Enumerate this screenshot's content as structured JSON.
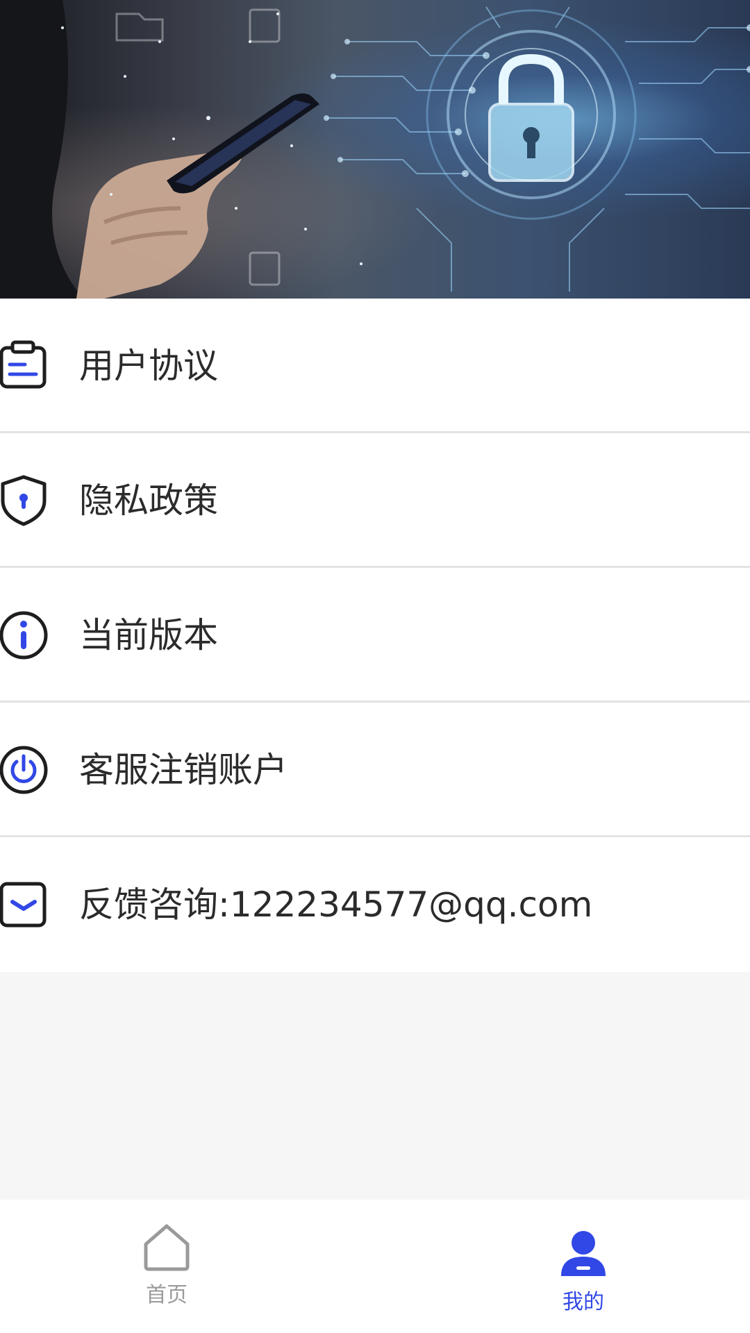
{
  "hero": {
    "icon": "security-lock-banner"
  },
  "menu": {
    "items": [
      {
        "label": "用户协议",
        "icon": "clipboard-icon"
      },
      {
        "label": "隐私政策",
        "icon": "shield-icon"
      },
      {
        "label": "当前版本",
        "icon": "info-icon"
      },
      {
        "label": "客服注销账户",
        "icon": "power-icon"
      },
      {
        "label": "反馈咨询:122234577@qq.com",
        "icon": "mail-icon"
      }
    ]
  },
  "tabbar": {
    "home_label": "首页",
    "mine_label": "我的",
    "active_tab": "我的"
  },
  "colors": {
    "accent": "#3148e6",
    "icon_dark": "#1e1e1e",
    "tab_inactive": "#9a9a9a",
    "background": "#f6f6f6"
  }
}
